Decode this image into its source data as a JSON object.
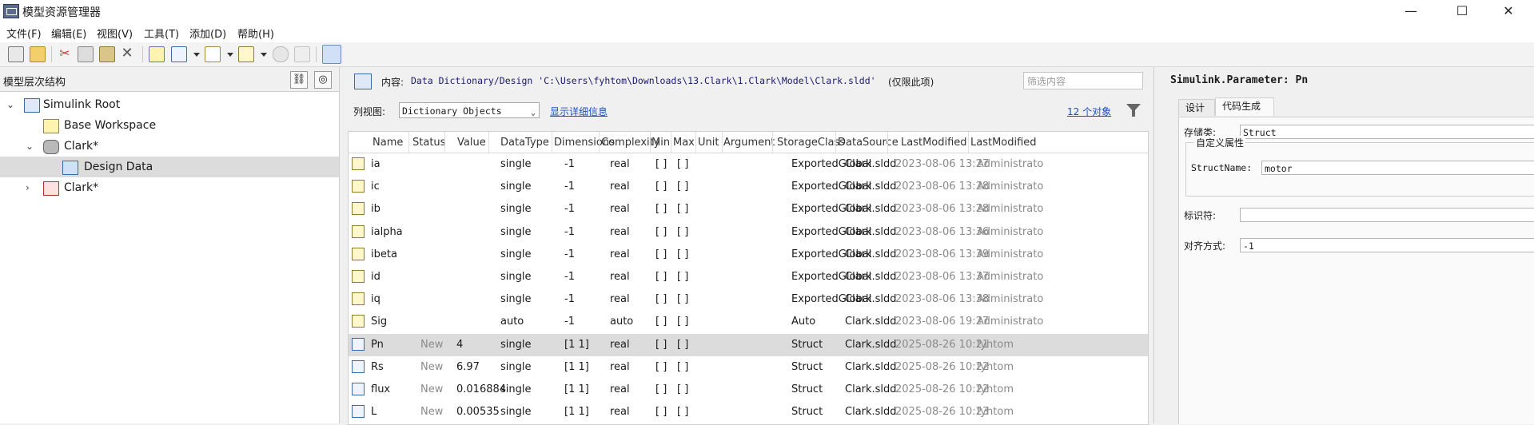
{
  "window": {
    "title": "模型资源管理器",
    "controls": {
      "minimize": "—",
      "maximize": "☐",
      "close": "✕"
    }
  },
  "menu": [
    "文件(F)",
    "编辑(E)",
    "视图(V)",
    "工具(T)",
    "添加(D)",
    "帮助(H)"
  ],
  "left_pane": {
    "header": "模型层次结构",
    "tree": [
      {
        "label": "Simulink Root",
        "icon": "simulink-root-icon"
      },
      {
        "label": "Base Workspace",
        "icon": "workspace-grid-icon"
      },
      {
        "label": "Clark*",
        "icon": "database-icon"
      },
      {
        "label": "Design Data",
        "icon": "design-data-icon"
      },
      {
        "label": "Clark*",
        "icon": "model-icon"
      }
    ]
  },
  "content": {
    "label": "内容:",
    "path": "Data Dictionary/Design 'C:\\Users\\fyhtom\\Downloads\\13.Clark\\1.Clark\\Model\\Clark.sldd'",
    "scope": "(仅限此项)",
    "filter_placeholder": "筛选内容",
    "column_view_label": "列视图:",
    "column_view_value": "Dictionary Objects",
    "show_details": "显示详细信息",
    "object_count": "12 个对象"
  },
  "table": {
    "columns": [
      "Name",
      "Status",
      "Value",
      "DataType",
      "Dimensions",
      "Complexity",
      "Min",
      "Max",
      "Unit",
      "Argument",
      "StorageClass",
      "DataSource",
      "LastModified",
      "LastModified"
    ],
    "rows": [
      {
        "name": "ia",
        "status": "",
        "value": "",
        "datatype": "single",
        "dims": "-1",
        "complexity": "real",
        "min": "[ ]",
        "max": "[ ]",
        "storage": "ExportedGlobal",
        "source": "Clark.sldd",
        "modified": "2023-08-06 13:27",
        "by": "Administrato",
        "kind": "signal"
      },
      {
        "name": "ic",
        "status": "",
        "value": "",
        "datatype": "single",
        "dims": "-1",
        "complexity": "real",
        "min": "[ ]",
        "max": "[ ]",
        "storage": "ExportedGlobal",
        "source": "Clark.sldd",
        "modified": "2023-08-06 13:28",
        "by": "Administrato",
        "kind": "signal"
      },
      {
        "name": "ib",
        "status": "",
        "value": "",
        "datatype": "single",
        "dims": "-1",
        "complexity": "real",
        "min": "[ ]",
        "max": "[ ]",
        "storage": "ExportedGlobal",
        "source": "Clark.sldd",
        "modified": "2023-08-06 13:28",
        "by": "Administrato",
        "kind": "signal"
      },
      {
        "name": "ialpha",
        "status": "",
        "value": "",
        "datatype": "single",
        "dims": "-1",
        "complexity": "real",
        "min": "[ ]",
        "max": "[ ]",
        "storage": "ExportedGlobal",
        "source": "Clark.sldd",
        "modified": "2023-08-06 13:36",
        "by": "Administrato",
        "kind": "signal"
      },
      {
        "name": "ibeta",
        "status": "",
        "value": "",
        "datatype": "single",
        "dims": "-1",
        "complexity": "real",
        "min": "[ ]",
        "max": "[ ]",
        "storage": "ExportedGlobal",
        "source": "Clark.sldd",
        "modified": "2023-08-06 13:39",
        "by": "Administrato",
        "kind": "signal"
      },
      {
        "name": "id",
        "status": "",
        "value": "",
        "datatype": "single",
        "dims": "-1",
        "complexity": "real",
        "min": "[ ]",
        "max": "[ ]",
        "storage": "ExportedGlobal",
        "source": "Clark.sldd",
        "modified": "2023-08-06 13:37",
        "by": "Administrato",
        "kind": "signal"
      },
      {
        "name": "iq",
        "status": "",
        "value": "",
        "datatype": "single",
        "dims": "-1",
        "complexity": "real",
        "min": "[ ]",
        "max": "[ ]",
        "storage": "ExportedGlobal",
        "source": "Clark.sldd",
        "modified": "2023-08-06 13:38",
        "by": "Administrato",
        "kind": "signal"
      },
      {
        "name": "Sig",
        "status": "",
        "value": "",
        "datatype": "auto",
        "dims": "-1",
        "complexity": "auto",
        "min": "[ ]",
        "max": "[ ]",
        "storage": "Auto",
        "source": "Clark.sldd",
        "modified": "2023-08-06 19:27",
        "by": "Administrato",
        "kind": "signal"
      },
      {
        "name": "Pn",
        "status": "New",
        "value": "4",
        "datatype": "single",
        "dims": "[1 1]",
        "complexity": "real",
        "min": "[ ]",
        "max": "[ ]",
        "storage": "Struct",
        "source": "Clark.sldd",
        "modified": "2025-08-26 10:21",
        "by": "fyhtom",
        "kind": "param"
      },
      {
        "name": "Rs",
        "status": "New",
        "value": "6.97",
        "datatype": "single",
        "dims": "[1 1]",
        "complexity": "real",
        "min": "[ ]",
        "max": "[ ]",
        "storage": "Struct",
        "source": "Clark.sldd",
        "modified": "2025-08-26 10:22",
        "by": "fyhtom",
        "kind": "param"
      },
      {
        "name": "flux",
        "status": "New",
        "value": "0.016884",
        "datatype": "single",
        "dims": "[1 1]",
        "complexity": "real",
        "min": "[ ]",
        "max": "[ ]",
        "storage": "Struct",
        "source": "Clark.sldd",
        "modified": "2025-08-26 10:22",
        "by": "fyhtom",
        "kind": "param"
      },
      {
        "name": "L",
        "status": "New",
        "value": "0.00535",
        "datatype": "single",
        "dims": "[1 1]",
        "complexity": "real",
        "min": "[ ]",
        "max": "[ ]",
        "storage": "Struct",
        "source": "Clark.sldd",
        "modified": "2025-08-26 10:23",
        "by": "fyhtom",
        "kind": "param"
      }
    ],
    "selected_row": "Pn"
  },
  "right_pane": {
    "title": "Simulink.Parameter: Pn",
    "tabs": [
      "设计",
      "代码生成"
    ],
    "active_tab": "代码生成",
    "storage_class_label": "存储类:",
    "storage_class_value": "Struct",
    "custom_attrs_label": "自定义属性",
    "struct_name_label": "StructName:",
    "struct_name_value": "motor",
    "identifier_label": "标识符:",
    "identifier_value": "",
    "alignment_label": "对齐方式:",
    "alignment_value": "-1"
  }
}
